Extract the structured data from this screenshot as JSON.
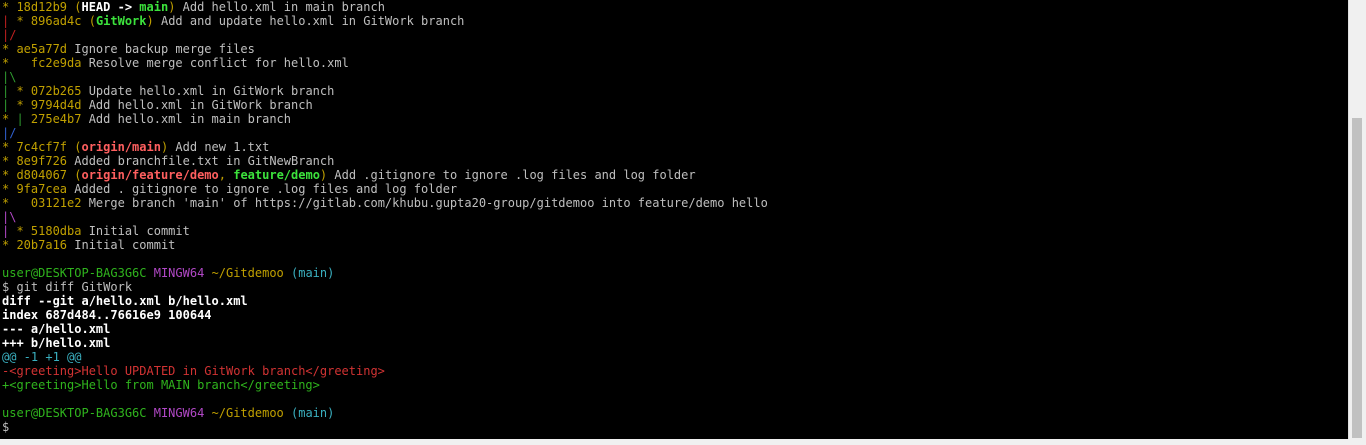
{
  "terminal": {
    "lines": [
      [
        {
          "t": "* ",
          "c": "c-graph-yellow"
        },
        {
          "t": "18d12b9 ",
          "c": "c-yellow"
        },
        {
          "t": "(",
          "c": "c-yellow"
        },
        {
          "t": "HEAD -> ",
          "c": "c-bold c-cyan"
        },
        {
          "t": "main",
          "c": "c-bgreen"
        },
        {
          "t": ") ",
          "c": "c-yellow"
        },
        {
          "t": "Add hello.xml in main branch",
          "c": "c-white"
        }
      ],
      [
        {
          "t": "| ",
          "c": "c-graph-red"
        },
        {
          "t": "* ",
          "c": "c-graph-yellow"
        },
        {
          "t": "896ad4c ",
          "c": "c-yellow"
        },
        {
          "t": "(",
          "c": "c-yellow"
        },
        {
          "t": "GitWork",
          "c": "c-bgreen"
        },
        {
          "t": ") ",
          "c": "c-yellow"
        },
        {
          "t": "Add and update hello.xml in GitWork branch",
          "c": "c-white"
        }
      ],
      [
        {
          "t": "|/",
          "c": "c-graph-red"
        }
      ],
      [
        {
          "t": "* ",
          "c": "c-graph-yellow"
        },
        {
          "t": "ae5a77d ",
          "c": "c-yellow"
        },
        {
          "t": "Ignore backup merge files",
          "c": "c-white"
        }
      ],
      [
        {
          "t": "*   ",
          "c": "c-graph-yellow"
        },
        {
          "t": "fc2e9da ",
          "c": "c-yellow"
        },
        {
          "t": "Resolve merge conflict for hello.xml",
          "c": "c-white"
        }
      ],
      [
        {
          "t": "|\\",
          "c": "c-graph-green"
        }
      ],
      [
        {
          "t": "| ",
          "c": "c-graph-green"
        },
        {
          "t": "* ",
          "c": "c-graph-yellow"
        },
        {
          "t": "072b265 ",
          "c": "c-yellow"
        },
        {
          "t": "Update hello.xml in GitWork branch",
          "c": "c-white"
        }
      ],
      [
        {
          "t": "| ",
          "c": "c-graph-green"
        },
        {
          "t": "* ",
          "c": "c-graph-yellow"
        },
        {
          "t": "9794d4d ",
          "c": "c-yellow"
        },
        {
          "t": "Add hello.xml in GitWork branch",
          "c": "c-white"
        }
      ],
      [
        {
          "t": "* ",
          "c": "c-graph-yellow"
        },
        {
          "t": "| ",
          "c": "c-graph-green"
        },
        {
          "t": "275e4b7 ",
          "c": "c-yellow"
        },
        {
          "t": "Add hello.xml in main branch",
          "c": "c-white"
        }
      ],
      [
        {
          "t": "|/",
          "c": "c-graph-blue"
        }
      ],
      [
        {
          "t": "* ",
          "c": "c-graph-yellow"
        },
        {
          "t": "7c4cf7f ",
          "c": "c-yellow"
        },
        {
          "t": "(",
          "c": "c-yellow"
        },
        {
          "t": "origin/main",
          "c": "c-bred"
        },
        {
          "t": ") ",
          "c": "c-yellow"
        },
        {
          "t": "Add new 1.txt",
          "c": "c-white"
        }
      ],
      [
        {
          "t": "* ",
          "c": "c-graph-yellow"
        },
        {
          "t": "8e9f726 ",
          "c": "c-yellow"
        },
        {
          "t": "Added branchfile.txt in GitNewBranch",
          "c": "c-white"
        }
      ],
      [
        {
          "t": "* ",
          "c": "c-graph-yellow"
        },
        {
          "t": "d804067 ",
          "c": "c-yellow"
        },
        {
          "t": "(",
          "c": "c-yellow"
        },
        {
          "t": "origin/feature/demo",
          "c": "c-bred"
        },
        {
          "t": ", ",
          "c": "c-yellow"
        },
        {
          "t": "feature/demo",
          "c": "c-bgreen"
        },
        {
          "t": ") ",
          "c": "c-yellow"
        },
        {
          "t": "Add .gitignore to ignore .log files and log folder",
          "c": "c-white"
        }
      ],
      [
        {
          "t": "* ",
          "c": "c-graph-yellow"
        },
        {
          "t": "9fa7cea ",
          "c": "c-yellow"
        },
        {
          "t": "Added . gitignore to ignore .log files and log folder",
          "c": "c-white"
        }
      ],
      [
        {
          "t": "*   ",
          "c": "c-graph-yellow"
        },
        {
          "t": "03121e2 ",
          "c": "c-yellow"
        },
        {
          "t": "Merge branch 'main' of https://gitlab.com/khubu.gupta20-group/gitdemoo into feature/demo hello",
          "c": "c-white"
        }
      ],
      [
        {
          "t": "|\\",
          "c": "c-graph-magenta"
        }
      ],
      [
        {
          "t": "| ",
          "c": "c-graph-magenta"
        },
        {
          "t": "* ",
          "c": "c-graph-yellow"
        },
        {
          "t": "5180dba ",
          "c": "c-yellow"
        },
        {
          "t": "Initial commit",
          "c": "c-white"
        }
      ],
      [
        {
          "t": "* ",
          "c": "c-graph-yellow"
        },
        {
          "t": "20b7a16 ",
          "c": "c-yellow"
        },
        {
          "t": "Initial commit",
          "c": "c-white"
        }
      ],
      [
        {
          "t": "",
          "c": "c-white"
        }
      ],
      [
        {
          "t": "user@DESKTOP-BAG3G6C ",
          "c": "c-prompt-user"
        },
        {
          "t": "MINGW64 ",
          "c": "c-magenta"
        },
        {
          "t": "~/Gitdemoo ",
          "c": "c-prompt-path"
        },
        {
          "t": "(main)",
          "c": "c-prompt-branch"
        }
      ],
      [
        {
          "t": "$ git diff GitWork",
          "c": "c-white"
        }
      ],
      [
        {
          "t": "diff --git a/hello.xml b/hello.xml",
          "c": "c-bold"
        }
      ],
      [
        {
          "t": "index 687d484..76616e9 100644",
          "c": "c-bold"
        }
      ],
      [
        {
          "t": "--- a/hello.xml",
          "c": "c-bold"
        }
      ],
      [
        {
          "t": "+++ b/hello.xml",
          "c": "c-bold"
        }
      ],
      [
        {
          "t": "@@ -1 +1 @@",
          "c": "c-cyan"
        }
      ],
      [
        {
          "t": "-<greeting>Hello UPDATED in GitWork branch</greeting>",
          "c": "c-red"
        }
      ],
      [
        {
          "t": "+<greeting>Hello from MAIN branch</greeting>",
          "c": "c-green"
        }
      ],
      [
        {
          "t": "",
          "c": "c-white"
        }
      ],
      [
        {
          "t": "user@DESKTOP-BAG3G6C ",
          "c": "c-prompt-user"
        },
        {
          "t": "MINGW64 ",
          "c": "c-magenta"
        },
        {
          "t": "~/Gitdemoo ",
          "c": "c-prompt-path"
        },
        {
          "t": "(main)",
          "c": "c-prompt-branch"
        }
      ],
      [
        {
          "t": "$",
          "c": "c-white"
        }
      ]
    ]
  }
}
